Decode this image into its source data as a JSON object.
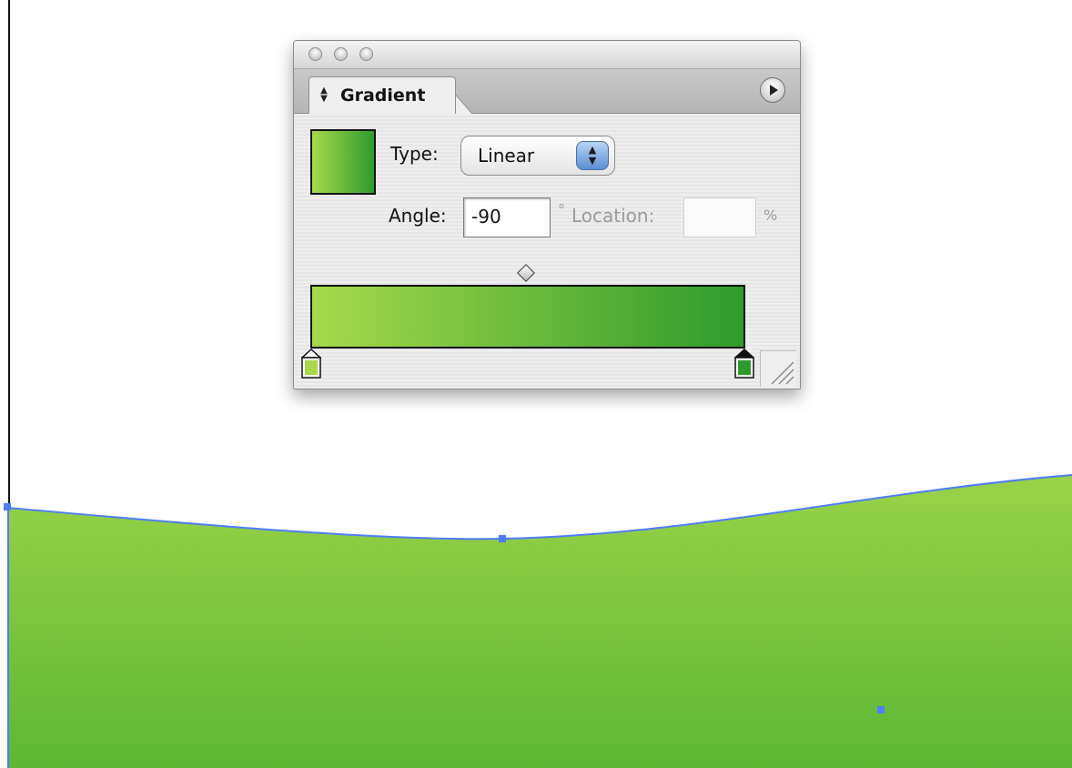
{
  "palette": {
    "tab_title": "Gradient",
    "type_label": "Type:",
    "type_value": "Linear",
    "angle_label": "Angle:",
    "angle_value": "-90",
    "degree_symbol": "°",
    "location_label": "Location:",
    "location_value": "",
    "percent_symbol": "%",
    "start_color": "#a6d94c",
    "end_color": "#2f9b2c"
  },
  "artwork": {
    "fill_top_color": "#9ad248",
    "fill_bottom_color": "#5db733",
    "path_color": "#4f7cff"
  }
}
